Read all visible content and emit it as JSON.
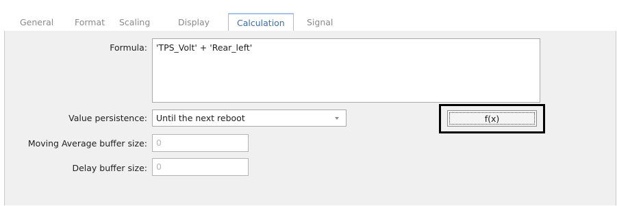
{
  "tabs": [
    {
      "label": "General",
      "active": false
    },
    {
      "label": "Format",
      "active": false
    },
    {
      "label": "Scaling",
      "active": false
    },
    {
      "label": "Display",
      "active": false
    },
    {
      "label": "Calculation",
      "active": true
    },
    {
      "label": "Signal",
      "active": false
    }
  ],
  "form": {
    "formula_label": "Formula:",
    "formula_value": "'TPS_Volt' + 'Rear_left'",
    "persistence_label": "Value persistence:",
    "persistence_value": "Until the next reboot",
    "mavg_label": "Moving Average buffer size:",
    "mavg_value": "0",
    "delay_label": "Delay buffer size:",
    "delay_value": "0",
    "fx_button_label": "f(x)"
  },
  "colors": {
    "active_tab_text": "#3a6cae",
    "inactive_tab_text": "#8a8a8a",
    "panel_bg": "#f0f0f0",
    "highlight_frame": "#000000"
  }
}
